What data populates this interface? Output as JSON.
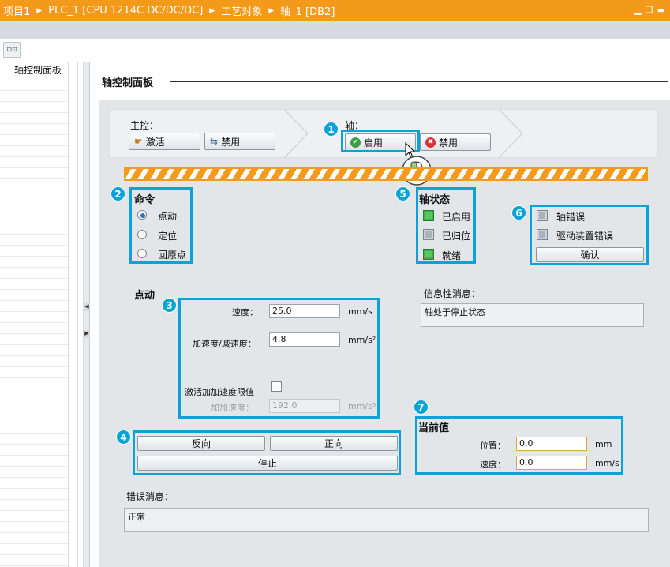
{
  "titlebar": {
    "crumbs": [
      "项目1",
      "PLC_1 [CPU 1214C DC/DC/DC]",
      "工艺对象",
      "轴_1 [DB2]"
    ]
  },
  "toolbar": {
    "icon": "network-view-icon"
  },
  "nav": {
    "item": "轴控制面板"
  },
  "page": {
    "title": "轴控制面板"
  },
  "master": {
    "label": "主控：",
    "activate": "激活",
    "disable": "禁用"
  },
  "axis": {
    "label": "轴：",
    "enable": "启用",
    "disable": "禁用"
  },
  "badges": [
    "1",
    "2",
    "3",
    "4",
    "5",
    "6",
    "7"
  ],
  "command": {
    "title": "命令",
    "options": [
      "点动",
      "定位",
      "回原点"
    ],
    "selected": 0
  },
  "axis_status": {
    "title": "轴状态",
    "items": [
      {
        "label": "已启用",
        "state": "green"
      },
      {
        "label": "已归位",
        "state": "grey"
      },
      {
        "label": "就绪",
        "state": "green"
      }
    ]
  },
  "errors": {
    "items": [
      "轴错误",
      "驱动装置错误"
    ],
    "ack": "确认"
  },
  "jog": {
    "title": "点动",
    "speed_label": "速度：",
    "speed_value": "25.0",
    "speed_unit": "mm/s",
    "accel_label": "加速度/减速度：",
    "accel_value": "4.8",
    "accel_unit": "mm/s²",
    "jerk_enable_label": "激活加加速度限值",
    "jerk_label": "加加速度：",
    "jerk_value": "192.0",
    "jerk_unit": "mm/s³"
  },
  "info": {
    "label": "信息性消息：",
    "text": "轴处于停止状态"
  },
  "jog_buttons": {
    "reverse": "反向",
    "forward": "正向",
    "stop": "停止"
  },
  "current": {
    "title": "当前值",
    "pos_label": "位置：",
    "pos_value": "0.0",
    "pos_unit": "mm",
    "vel_label": "速度：",
    "vel_value": "0.0",
    "vel_unit": "mm/s"
  },
  "error_msg": {
    "label": "错误消息：",
    "text": "正常"
  },
  "colors": {
    "title_bar": "#f39a1a",
    "callout": "#0aa3d9",
    "status_green": "#3cb34a"
  }
}
